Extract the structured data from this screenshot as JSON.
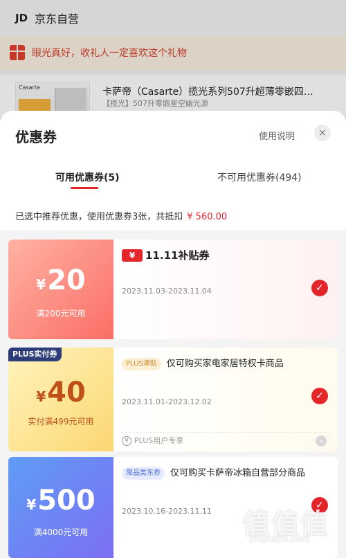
{
  "background": {
    "shop_logo": "JD",
    "shop_name": "京东自营",
    "gift_banner": "眼光真好，收礼人一定喜欢这个礼物",
    "product": {
      "title": "卡萨帝（Casarte）揽光系列507升超薄零嵌四…",
      "subtitle": "【揽光】507升零嵌星空幽光源",
      "brand_label": "Casarte"
    }
  },
  "sheet": {
    "title": "优惠券",
    "help_label": "使用说明",
    "close_icon": "×",
    "tabs": [
      {
        "label": "可用优惠券(5)",
        "active": true
      },
      {
        "label": "不可用优惠券(494)",
        "active": false
      }
    ],
    "note": "已选中推荐优惠，使用优惠券3张，共抵扣",
    "note_amount": "¥ 560.00"
  },
  "coupons": [
    {
      "currency": "¥",
      "amount": "20",
      "condition": "满200元可用",
      "badge_symbol": "¥",
      "title": "11.11补贴券",
      "date": "2023.11.03-2023.11.04",
      "selected": true,
      "gradient": [
        "#ffb2a3",
        "#fb6e66"
      ]
    },
    {
      "currency": "¥",
      "amount": "40",
      "condition": "实付满499元可用",
      "ribbon": "PLUS实付券",
      "tag": "PLUS津贴",
      "desc": "仅可购买家电家居特权卡商品",
      "date": "2023.11.01-2023.12.02",
      "footer_symbol": "¥",
      "footer": "PLUS用户专享",
      "selected": true,
      "gradient": [
        "#fff4bd",
        "#fcd772"
      ]
    },
    {
      "currency": "¥",
      "amount": "500",
      "condition": "满4000元可用",
      "tag": "限品类东券",
      "desc": "仅可购买卡萨帝冰箱自营部分商品",
      "date": "2023.10.16-2023.11.11",
      "selected": true,
      "gradient": [
        "#5f9cf6",
        "#7c6ff2"
      ]
    }
  ],
  "watermark": {
    "text": "值值值",
    "url": "zhizhizhi.com"
  },
  "icons": {
    "check": "check-icon",
    "close": "close-icon",
    "gift": "gift-icon",
    "chevron": "chevron-down-icon"
  },
  "colors": {
    "accent_red": "#e4262b",
    "plus_gold": "#c9872b"
  }
}
